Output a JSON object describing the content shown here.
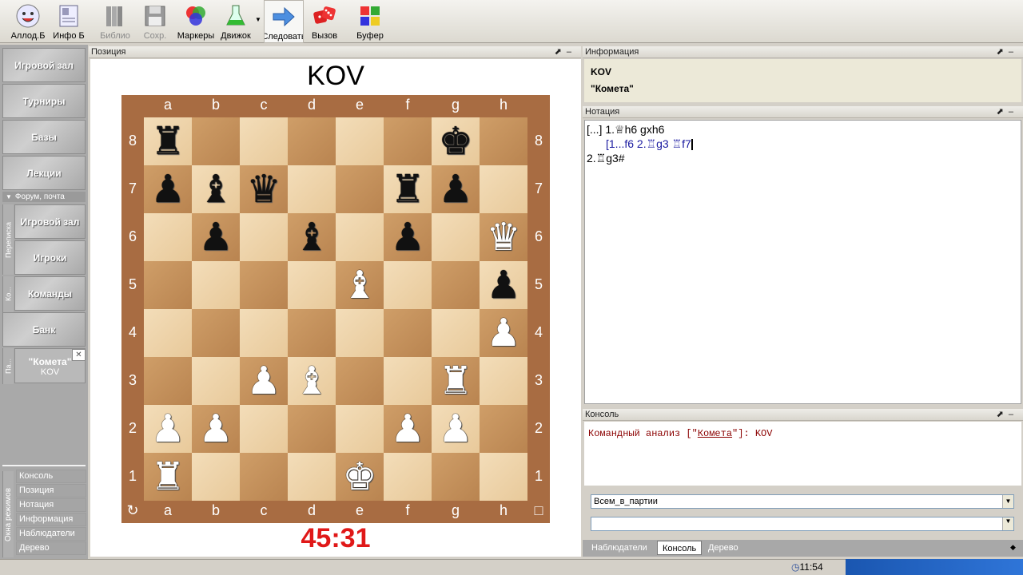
{
  "toolbar": {
    "items": [
      {
        "label": "Аллод.Б",
        "icon": "smiley-icon",
        "enabled": true
      },
      {
        "label": "Инфо Б",
        "icon": "info-card-icon",
        "enabled": true
      },
      {
        "label": "Библио",
        "icon": "books-icon",
        "enabled": false
      },
      {
        "label": "Сохр.",
        "icon": "save-icon",
        "enabled": false
      },
      {
        "label": "Маркеры",
        "icon": "markers-icon",
        "enabled": true
      },
      {
        "label": "Движок",
        "icon": "flask-icon",
        "enabled": true
      },
      {
        "label": "Следовать",
        "icon": "arrow-right-icon",
        "enabled": true
      },
      {
        "label": "Вызов",
        "icon": "dice-icon",
        "enabled": true
      },
      {
        "label": "Буфер",
        "icon": "puzzle-icon",
        "enabled": true
      }
    ]
  },
  "sidebar": {
    "main_buttons": [
      "Игровой зал",
      "Турниры",
      "Базы",
      "Лекции"
    ],
    "forum_header": "Форум, почта",
    "sub_buttons": [
      "Игровой зал",
      "Игроки",
      "Команды",
      "Банк"
    ],
    "vtabs": [
      "Переписка",
      "Ко...",
      "Па..."
    ],
    "game_tab": {
      "title": "\"Комета\"",
      "subtitle": "KOV",
      "close": "✕"
    },
    "modes_label": "Окна режимов",
    "modes": [
      "Консоль",
      "Позиция",
      "Нотация",
      "Информация",
      "Наблюдатели",
      "Дерево"
    ]
  },
  "position_panel": {
    "title": "Позиция",
    "player_top": "KOV",
    "clock": "45:31",
    "files": [
      "a",
      "b",
      "c",
      "d",
      "e",
      "f",
      "g",
      "h"
    ],
    "ranks": [
      "8",
      "7",
      "6",
      "5",
      "4",
      "3",
      "2",
      "1"
    ],
    "pieces": [
      [
        "r",
        "",
        "",
        "",
        "",
        "",
        "k",
        ""
      ],
      [
        "p",
        "b",
        "q",
        "",
        "",
        "r",
        "p",
        ""
      ],
      [
        "",
        "p",
        "",
        "b",
        "",
        "p",
        "",
        "Q"
      ],
      [
        "",
        "",
        "",
        "",
        "B",
        "",
        "",
        "p"
      ],
      [
        "",
        "",
        "",
        "",
        "",
        "",
        "",
        "P"
      ],
      [
        "",
        "",
        "P",
        "B",
        "",
        "",
        "R",
        ""
      ],
      [
        "P",
        "P",
        "",
        "",
        "",
        "P",
        "P",
        ""
      ],
      [
        "R",
        "",
        "",
        "",
        "K",
        "",
        "",
        ""
      ]
    ],
    "flip_symbol": "↻",
    "side_marker": "□"
  },
  "info_panel": {
    "title": "Информация",
    "line1": "KOV",
    "line2": "\"Комета\""
  },
  "notation_panel": {
    "title": "Нотация",
    "line1": "[...] 1.♕h6 gxh6",
    "line2": "[1...f6 2.♖g3 ♖f7",
    "line3": "2.♖g3#"
  },
  "console_panel": {
    "title": "Консоль",
    "msg_prefix": "Командный анализ [\"",
    "msg_link": "Комета",
    "msg_suffix": "\"]: KOV",
    "dropdown1": "Всем_в_партии",
    "dropdown2": "",
    "tabs": [
      "Наблюдатели",
      "Консоль",
      "Дерево"
    ],
    "active_tab": "Консоль"
  },
  "statusbar": {
    "time": "11:54"
  },
  "colors": {
    "clock": "#e01818",
    "console_text": "#8b0000",
    "notation_variation": "#1a1aa0"
  }
}
